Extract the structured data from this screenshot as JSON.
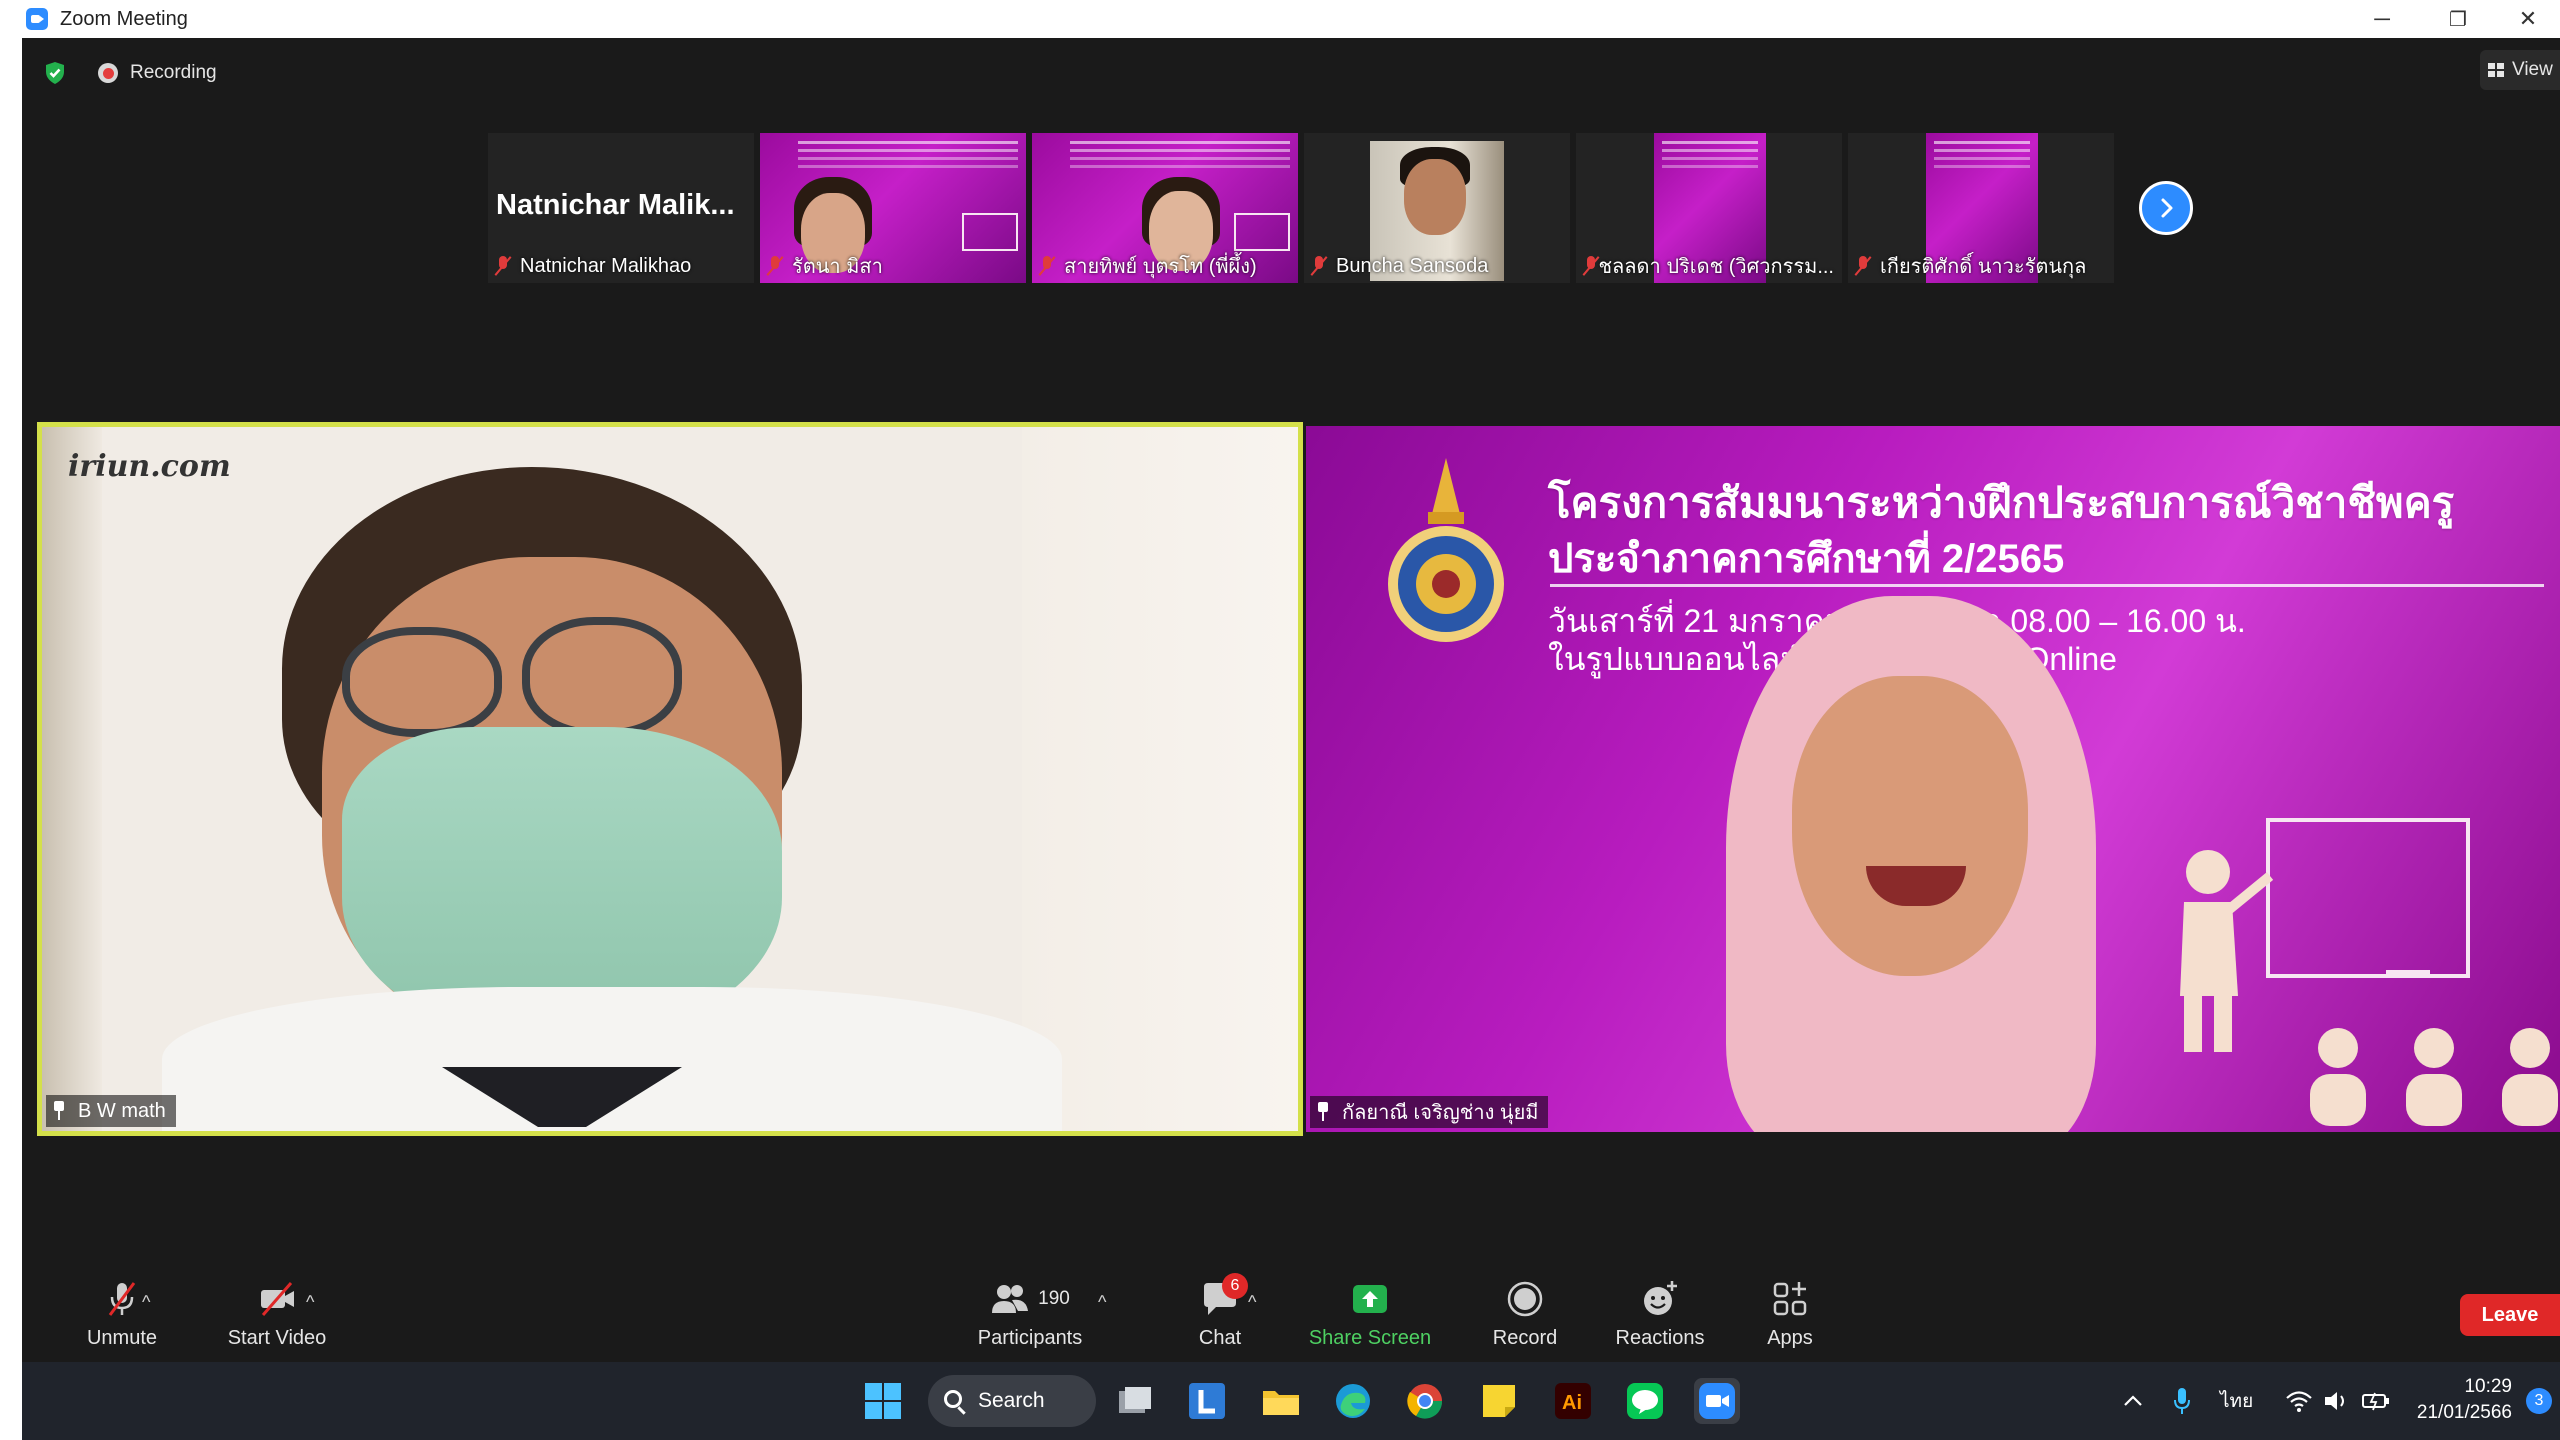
{
  "window": {
    "title": "Zoom Meeting",
    "controls": {
      "minimize": "─",
      "restore": "❐",
      "close": "✕"
    }
  },
  "status": {
    "recording_label": "Recording",
    "view_label": "View"
  },
  "strip": {
    "name_only_tile": "Natnichar  Malik...",
    "tiles": [
      {
        "label": "Natnichar Malikhao"
      },
      {
        "label": "รัตนา มิสา"
      },
      {
        "label": "สายทิพย์ บุตรโท (พี่ผึ้ง)"
      },
      {
        "label": "Buncha Sansoda"
      },
      {
        "label": "ชลลดา ปริเดช (วิศวกรรม..."
      },
      {
        "label": "เกียรติศักดิ์ นาวะรัตนกุล"
      }
    ]
  },
  "main": {
    "left_tile": {
      "name": "B W math",
      "watermark": "iriun.com"
    },
    "right_tile": {
      "name": "กัลยาณี เจริญช่าง นุ่ยมี",
      "slide_title": "โครงการสัมมนาระหว่างฝึกประสบการณ์วิชาชีพครู",
      "slide_subtitle": "ประจำภาคการศึกษาที่ 2/2565",
      "slide_date": "วันเสาร์ที่ 21 มกราคม 2566 เวลา 08.00 – 16.00 น.",
      "slide_mode": "ในรูปแบบออนไลน์ Zoom Meeting Online"
    }
  },
  "toolbar": {
    "unmute": "Unmute",
    "start_video": "Start Video",
    "participants": "Participants",
    "participants_count": "190",
    "chat": "Chat",
    "chat_badge": "6",
    "share_screen": "Share Screen",
    "record": "Record",
    "reactions": "Reactions",
    "apps": "Apps",
    "leave": "Leave",
    "caret": "^"
  },
  "taskbar": {
    "search_label": "Search",
    "language": "ไทย",
    "time": "10:29",
    "date": "21/01/2566",
    "notifications": "3"
  },
  "colors": {
    "accent": "#2d8cff",
    "leave": "#e02828",
    "share": "#4ed062",
    "active_speaker_border": "#d4e04a",
    "slide_purple": "#b81cbf"
  }
}
